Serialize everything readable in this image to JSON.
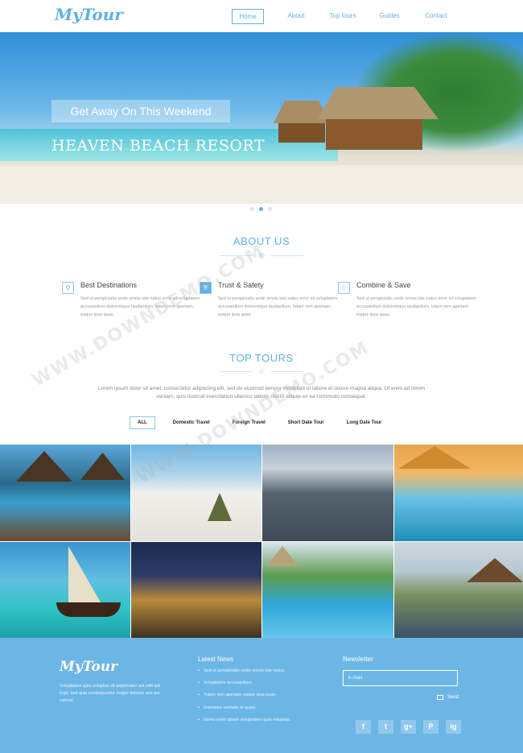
{
  "header": {
    "logo": "MyTour",
    "nav": [
      "Home",
      "About",
      "Top tours",
      "Guides",
      "Contact"
    ]
  },
  "hero": {
    "tagline": "Get Away On This Weekend",
    "title": "HEAVEN BEACH RESORT",
    "slides": 3,
    "active_slide": 2
  },
  "about": {
    "heading": "ABOUT US",
    "features": [
      {
        "icon": "map-pin-icon",
        "title": "Best Destinations",
        "text": "Sed ut perspiciatis unde omnis iste natus error sit voluptatem accusantium doloremque laudantium, totam rem aperiam, eaque ipsa quae."
      },
      {
        "icon": "shield-icon",
        "title": "Trust & Safety",
        "text": "Sed ut perspiciatis unde omnis iste natus error sit voluptatem accusantium doloremque laudantium, totam rem aperiam, eaque ipsa quae."
      },
      {
        "icon": "star-icon",
        "title": "Combine & Save",
        "text": "Sed ut perspiciatis unde omnis iste natus error sit voluptatem accusantium doloremque laudantium, totam rem aperiam, eaque ipsa quae."
      }
    ]
  },
  "tours": {
    "heading": "TOP TOURS",
    "intro": "Lorem ipsum dolor sit amet, consectetur adipiscing elit, sed do eiusmod tempor incididunt ut labore et dolore magna aliqua. Ut enim ad minim veniam, quis nostrud exercitation ullamco laboris nisi ut aliquip ex ea commodo consequat.",
    "filters": [
      "ALL",
      "Domestic Travel",
      "Foreign Travel",
      "Short Date Tour",
      "Long Date Tour"
    ],
    "active_filter": "ALL"
  },
  "footer": {
    "logo": "MyTour",
    "about": "Voluptatem quia voluptas sit aspernatur aut odit aut fugit, sed quia consequuntur magni dolores eos qui ratione.",
    "news_title": "Latest News",
    "news": [
      "Sed ut perspiciatis unde omnis iste natus.",
      "Voluptatem accusantium.",
      "Totam rem aperiam eaque ipsa quae.",
      "Inventore veritatis et quasi.",
      "Nemo enim ipsam voluptatem quia voluptas."
    ],
    "newsletter_title": "Newsletter",
    "email_placeholder": "E-mail",
    "send_label": "Send",
    "social": [
      "f",
      "t",
      "g+",
      "P",
      "ig"
    ]
  },
  "watermark": "WWW.DOWNDEMO.COM",
  "colors": {
    "accent": "#5fb1e6",
    "footer": "#6cb6e6"
  }
}
